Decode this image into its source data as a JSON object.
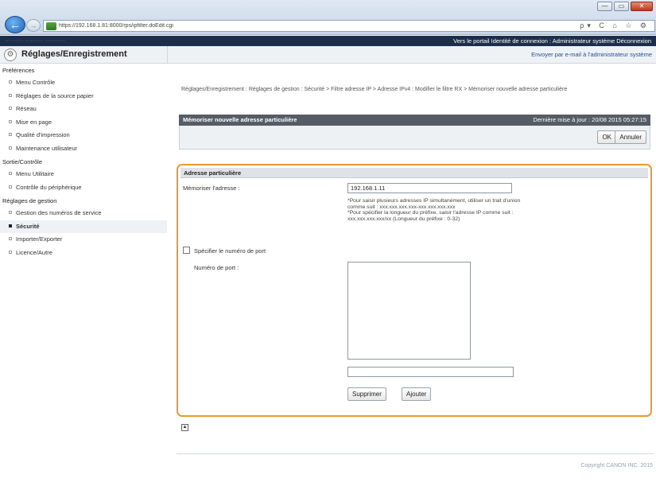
{
  "browser": {
    "url": "https://192.168.1.81:8000/rps/ipfilter.doEdit.cgi",
    "address_tools": "ρ▾ C   ⌂ ☆ ⚙",
    "window_buttons": [
      "—",
      "▭",
      "✕"
    ]
  },
  "portal": {
    "blurred_text": "·········· ··········  ···········",
    "links": "Vers le portail  Identité de connexion : Administrateur système  Déconnexion"
  },
  "header": {
    "title": "Réglages/Enregistrement",
    "mail_link": "Envoyer par e-mail à l'administrateur système"
  },
  "sidebar": {
    "sections": [
      {
        "title": "Préférences",
        "items": [
          "Menu Contrôle",
          "Réglages de la source papier",
          "Réseau",
          "Mise en page",
          "Qualité d'impression",
          "Maintenance utilisateur"
        ]
      },
      {
        "title": "Sortie/Contrôle",
        "items": [
          "Menu Utilitaire",
          "Contrôle du périphérique"
        ]
      },
      {
        "title": "Réglages de gestion",
        "items": [
          "Gestion des numéros de service",
          "Sécurité",
          "Importer/Exporter",
          "Licence/Autre"
        ]
      }
    ],
    "active_item": "Sécurité"
  },
  "main": {
    "breadcrumb": "Réglages/Enregistrement : Réglages de gestion : Sécurité > Filtre adresse IP > Adresse IPv4 : Modifier le filtre RX > Mémoriser nouvelle adresse particulière",
    "panel_title": "Mémoriser nouvelle adresse particulière",
    "last_update": "Dernière mise à jour : 20/08 2015 05:27:15",
    "ok_label": "OK",
    "cancel_label": "Annuler",
    "section_title": "Adresse particulière",
    "address_label": "Mémoriser l'adresse :",
    "address_value": "192.168.1.11",
    "note_lines": [
      "*Pour saisir plusieurs adresses IP simultanément, utiliser un trait d'union",
      "comme suit : xxx.xxx.xxx.xxx-xxx.xxx.xxx.xxx",
      "*Pour spécifier la longueur du préfixe, saisir l'adresse IP comme suit :",
      "xxx.xxx.xxx.xxx/xx (Longueur du préfixe : 0-32)"
    ],
    "port_checkbox_label": "Spécifier le numéro de port",
    "port_label": "Numéro de port :",
    "delete_label": "Supprimer",
    "add_label": "Ajouter"
  },
  "footer": {
    "copyright": "Copyright CANON INC. 2015"
  },
  "colors": {
    "frame_border": "#ea9a2e",
    "panel_head": "#555c66",
    "portal_bar": "#1c2e4a"
  }
}
